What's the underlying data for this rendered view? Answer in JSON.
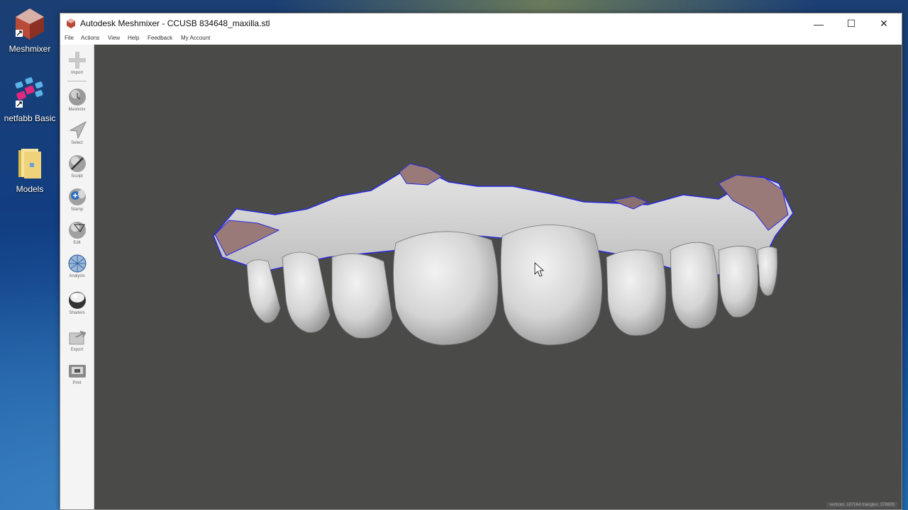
{
  "desktop": {
    "icons": [
      {
        "label": "Meshmixer"
      },
      {
        "label": "netfabb Basic"
      },
      {
        "label": "Models"
      }
    ]
  },
  "window": {
    "title": "Autodesk Meshmixer - CCUSB 834648_maxilla.stl",
    "controls": {
      "minimize": "—",
      "maximize": "☐",
      "close": "✕"
    }
  },
  "menu": [
    "File",
    "Actions",
    "View",
    "Help",
    "Feedback",
    "My Account"
  ],
  "toolbar": [
    {
      "label": "Import",
      "icon": "plus-icon"
    },
    {
      "label": "Meshmix",
      "icon": "meshmix-sphere-icon"
    },
    {
      "label": "Select",
      "icon": "select-arrow-icon"
    },
    {
      "label": "Sculpt",
      "icon": "sculpt-brush-icon"
    },
    {
      "label": "Stamp",
      "icon": "stamp-icon"
    },
    {
      "label": "Edit",
      "icon": "edit-sphere-icon"
    },
    {
      "label": "Analysis",
      "icon": "analysis-globe-icon"
    },
    {
      "label": "Shaders",
      "icon": "shader-sphere-icon"
    },
    {
      "label": "Export",
      "icon": "export-icon"
    },
    {
      "label": "Print",
      "icon": "print-icon"
    }
  ],
  "status": {
    "text": "vertices: 187164 triangles: 378809"
  },
  "colors": {
    "viewport": "#4a4a48",
    "boundary": "#2a2ae0",
    "tooth": "#d8d8d8"
  }
}
